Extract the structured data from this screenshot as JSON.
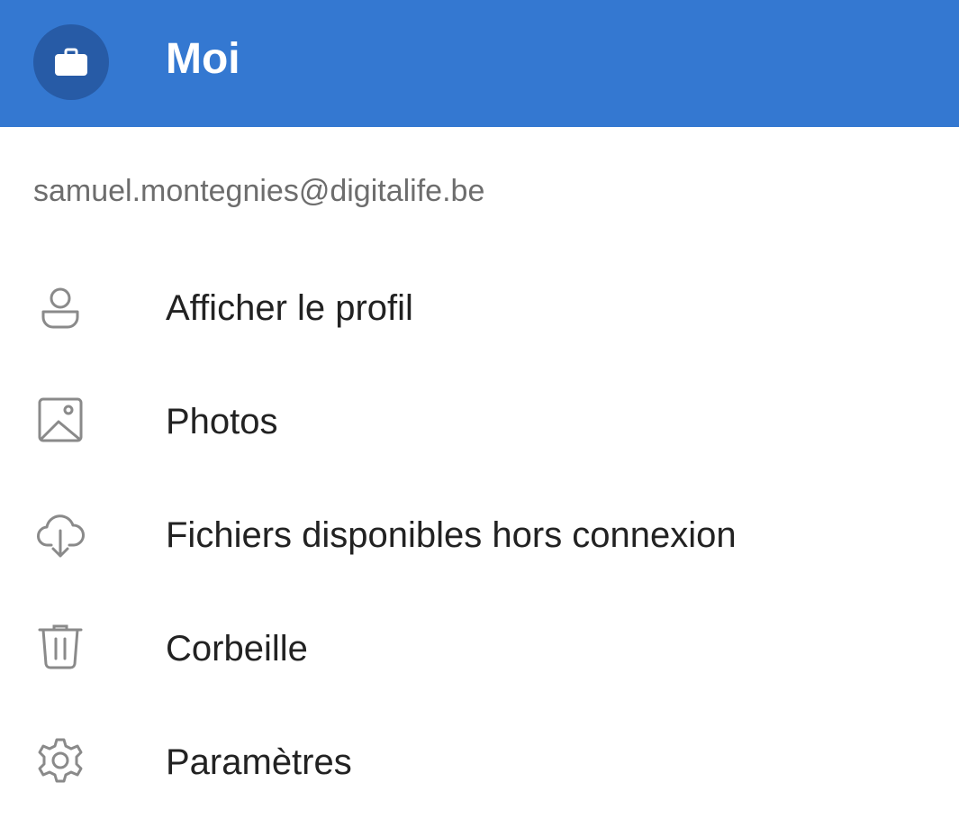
{
  "header": {
    "title": "Moi",
    "accent_color": "#3478d1",
    "avatar_icon": "briefcase-icon"
  },
  "account": {
    "email": "samuel.montegnies@digitalife.be"
  },
  "menu": {
    "items": [
      {
        "label": "Afficher le profil",
        "icon": "user-icon"
      },
      {
        "label": "Photos",
        "icon": "image-icon"
      },
      {
        "label": "Fichiers disponibles hors connexion",
        "icon": "cloud-download-icon"
      },
      {
        "label": "Corbeille",
        "icon": "trash-icon"
      },
      {
        "label": "Paramètres",
        "icon": "gear-icon"
      }
    ]
  }
}
